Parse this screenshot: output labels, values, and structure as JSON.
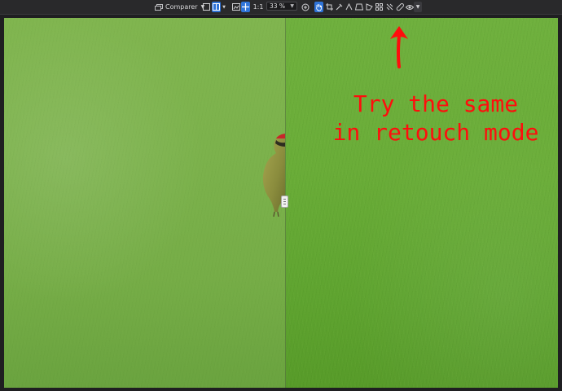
{
  "toolbar": {
    "compare_label": "Comparer",
    "zoom_fit_label": "1:1",
    "zoom_value": "33 %",
    "icons": [
      "window-icon",
      "single-view-icon",
      "split-view-icon",
      "preview-icon",
      "move-icon",
      "zoom-in-icon",
      "hand-icon",
      "crop-icon",
      "picker-icon",
      "straighten-icon",
      "perspective-icon",
      "shape-icon",
      "grid-icon",
      "retouch-icon",
      "eye-icon",
      "dropdown-icon"
    ]
  },
  "annotation": {
    "text": "Try the same\nin retouch mode"
  },
  "colors": {
    "annotation": "#ff0d0d",
    "active_tool": "#2f74d9",
    "toolbar_bg": "#29292b"
  }
}
